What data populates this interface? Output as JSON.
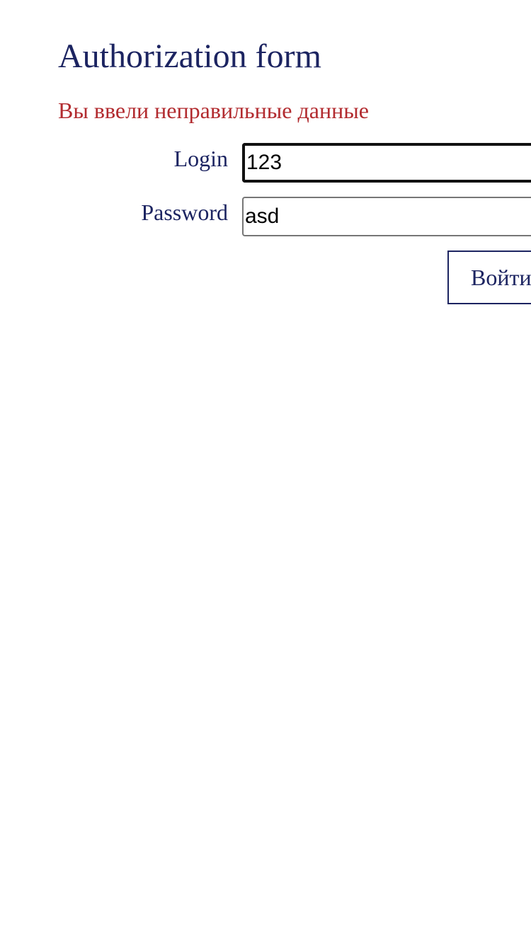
{
  "form": {
    "title": "Authorization form",
    "error_message": "Вы ввели неправильные данные",
    "login_label": "Login",
    "login_value": "123",
    "password_label": "Password",
    "password_value": "asd",
    "submit_label": "Войти"
  },
  "colors": {
    "text": "#1c2461",
    "error": "#b22b2f"
  }
}
